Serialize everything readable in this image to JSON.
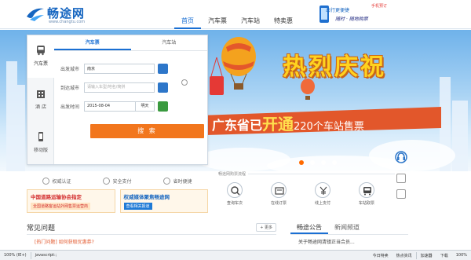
{
  "header": {
    "logo_text": "畅途网",
    "logo_sub": "www.changtu.com",
    "nav": [
      {
        "label": "首页",
        "active": true
      },
      {
        "label": "汽车票",
        "active": false
      },
      {
        "label": "汽车站",
        "active": false
      },
      {
        "label": "特卖惠",
        "active": false
      }
    ],
    "promo_tag": "手机预订",
    "promo_title": "出行更便捷",
    "promo_sub": "随时 · 随地购票"
  },
  "banner": {
    "title": "热烈庆祝",
    "ribbon_prefix": "广东省已",
    "ribbon_highlight": "开通",
    "ribbon_suffix": "220个车站售票",
    "slide_count": 4,
    "active_slide": 1
  },
  "booking": {
    "side_tabs": [
      {
        "label": "汽车票",
        "icon": "bus-icon",
        "active": true
      },
      {
        "label": "酒 店",
        "icon": "hotel-icon",
        "active": false
      },
      {
        "label": "移动版",
        "icon": "mobile-icon",
        "active": false
      }
    ],
    "top_tabs": [
      {
        "label": "汽车票",
        "active": true
      },
      {
        "label": "汽车站",
        "active": false
      }
    ],
    "departure_label": "出发城市",
    "departure_value": "南京",
    "arrival_label": "到达城市",
    "arrival_placeholder": "请输入车型/地名/简拼",
    "date_label": "出发时间",
    "date_value": "2015-08-04",
    "weekday": "明天",
    "search_label": "搜 索"
  },
  "trust": [
    {
      "label": "权威认证",
      "icon": "shield-icon"
    },
    {
      "label": "安全支付",
      "icon": "lock-icon"
    },
    {
      "label": "省时便捷",
      "icon": "clock-icon"
    }
  ],
  "ads": [
    {
      "title": "中国道路运输协会指定",
      "sub": "全国道路客运站外网售票运营商",
      "color": "red"
    },
    {
      "title": "权威媒体聚焦畅途网",
      "sub": "查看相关报道",
      "color": "blue"
    }
  ],
  "process": {
    "title": "畅途网购票流程",
    "steps": [
      {
        "label": "查询车次",
        "icon": "search-icon"
      },
      {
        "label": "在线订票",
        "icon": "ticket-icon"
      },
      {
        "label": "线上支付",
        "icon": "yen-icon"
      },
      {
        "label": "车站取票",
        "icon": "bus-stop-icon"
      }
    ]
  },
  "faq": {
    "title": "常见问题",
    "more_label": "更多",
    "items": [
      "[热门问题] 如何获取优惠券?"
    ]
  },
  "notice": {
    "tabs": [
      {
        "label": "畅途公告",
        "active": true
      },
      {
        "label": "新闻频道",
        "active": false
      }
    ],
    "items": [
      "关于畅途网清镇正当合员..."
    ]
  },
  "statusbar": {
    "left": "100% (IE+)",
    "app": "javascript:;",
    "items": [
      "今日特卖",
      "热点资讯",
      "加速器",
      "下载",
      "100%"
    ]
  },
  "colors": {
    "brand_blue": "#1a6fd3",
    "search_orange": "#f2761d",
    "ribbon_red": "#e2572b",
    "title_yellow": "#ffd21f"
  }
}
